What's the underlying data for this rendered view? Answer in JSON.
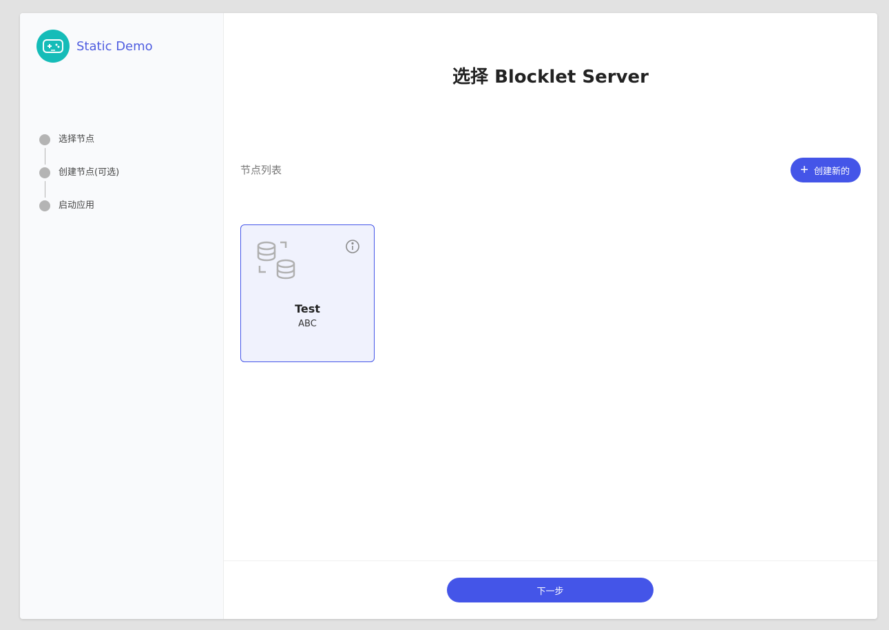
{
  "app": {
    "name": "Static Demo",
    "logo_icon": "gamepad-icon",
    "logo_color": "#15bcb8"
  },
  "steps": [
    {
      "label": "选择节点"
    },
    {
      "label": "创建节点(可选)"
    },
    {
      "label": "启动应用"
    }
  ],
  "main": {
    "title": "选择 Blocklet Server",
    "section_label": "节点列表",
    "create_button": {
      "label": "创建新的",
      "icon": "plus-icon"
    }
  },
  "nodes": [
    {
      "name": "Test",
      "description": "ABC",
      "icon": "database-sync-icon"
    }
  ],
  "footer": {
    "next_label": "下一步"
  },
  "colors": {
    "accent": "#4455e8",
    "brand_text": "#4f5de0",
    "step_dot": "#b4b4b4"
  }
}
